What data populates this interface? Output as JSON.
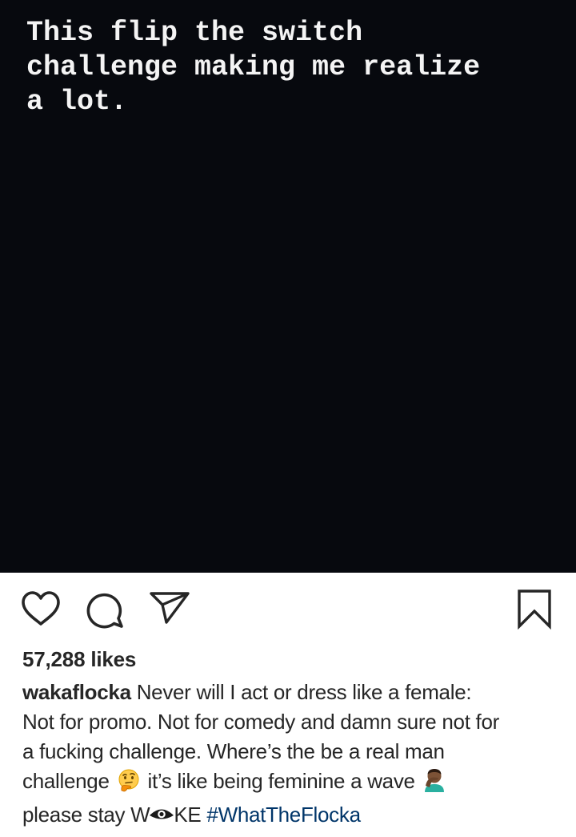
{
  "post": {
    "media_text": "This flip the switch\nchallenge making me realize\na lot.",
    "likes_text": "57,288 likes",
    "caption": {
      "username": "wakaflocka",
      "line_1": "Never will I act or dress like a female:",
      "line_2": "Not for promo. Not for comedy and damn sure not for",
      "line_3": "a fucking challenge. Where’s the be a real man",
      "line_4a": "challenge",
      "line_4b": "it’s like being feminine a wave",
      "line_5a": "please stay W",
      "line_5b": "KE",
      "hashtag": "#WhatTheFlocka"
    }
  },
  "icons": {
    "like": "heart-outline-icon",
    "comment": "speech-bubble-icon",
    "share": "paper-plane-icon",
    "save": "bookmark-outline-icon",
    "emoji_1": "thinking-face-emoji",
    "emoji_2": "man-facepalming-emoji",
    "eye": "eye-icon"
  },
  "colors": {
    "media_background": "#07090e",
    "media_text": "#f4f4f4",
    "text": "#262626",
    "hashtag": "#003569"
  }
}
